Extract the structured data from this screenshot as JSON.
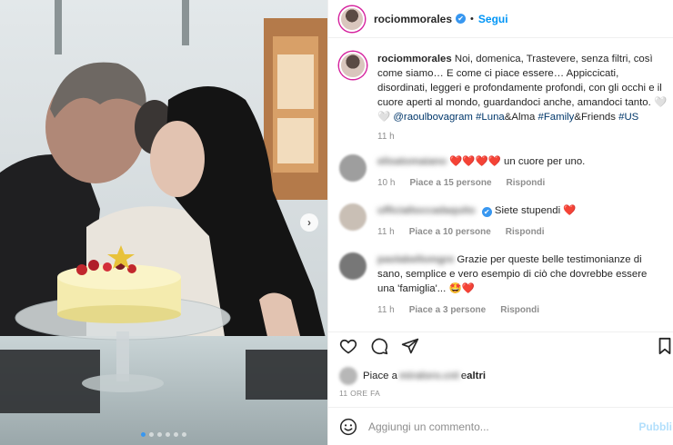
{
  "post": {
    "username": "rociommorales",
    "separator": "•",
    "follow_label": "Segui",
    "verified_glyph": "✔",
    "next_icon": "chevron-right-icon",
    "carousel": {
      "count": 6,
      "active": 0
    }
  },
  "caption": {
    "username": "rociommorales",
    "text_1": " Noi, domenica, Trastevere, senza filtri, così come siamo… E come ci piace essere… Appiccicati, disordinati, leggeri e profondamente profondi, con gli occhi e il cuore aperti al mondo, guardandoci anche, amandoci tanto. 🤍🤍",
    "mention": "@raoulbovagram",
    "tag_luna": "#Luna",
    "amp_alma": "&Alma ",
    "tag_family": "#Family",
    "amp_friends": "&Friends ",
    "tag_us": "#US",
    "time": "11 h"
  },
  "comments": [
    {
      "user": "elisatomaiano",
      "text_heart": "❤️❤️❤️❤️",
      "text": " un cuore per uno.",
      "time": "10 h",
      "likes": "Piace a 15 persone",
      "reply": "Rispondi"
    },
    {
      "user": "ufficialtoccadaquito",
      "verified_glyph": "✔",
      "text": " Siete stupendi ",
      "text_heart": "❤️",
      "time": "11 h",
      "likes": "Piace a 10 persone",
      "reply": "Rispondi"
    },
    {
      "user": "paolabellomgre",
      "text": " Grazie per queste belle testimonianze di sano, semplice e vero esempio di ciò che dovrebbe essere una 'famiglia'... ",
      "text_heart": "🤩❤️",
      "time": "11 h",
      "likes": "Piace a 3 persone",
      "reply": "Rispondi"
    }
  ],
  "actions": {
    "likes_prefix": "Piace a ",
    "likes_user": "miraloro.cnt",
    "likes_mid": " e ",
    "likes_others": "altri",
    "posted_ago": "11 ORE FA",
    "comment_placeholder": "Aggiungi un commento...",
    "publish_label": "Pubbli"
  },
  "colors": {
    "accent": "#0095f6",
    "heart": "#ed1c24",
    "muted": "#8e8e8e"
  }
}
